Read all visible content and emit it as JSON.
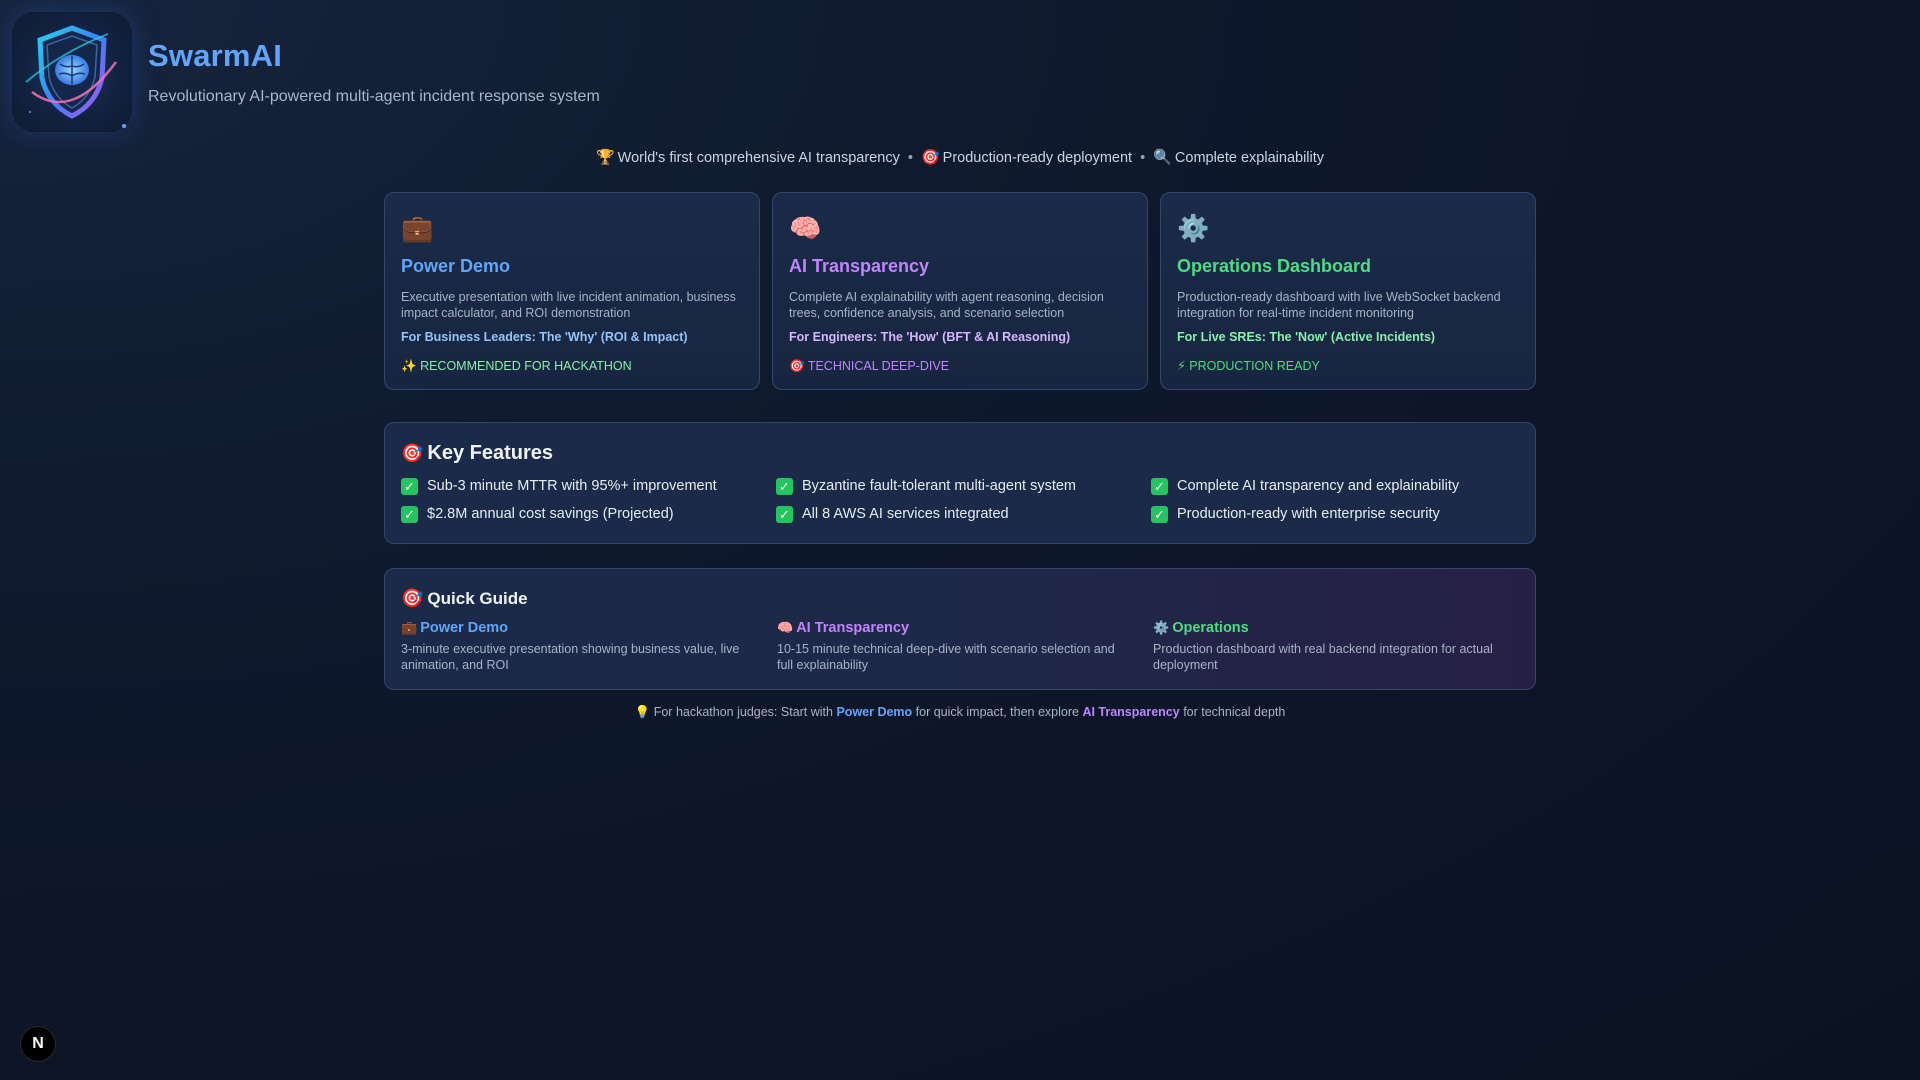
{
  "header": {
    "title": "SwarmAI",
    "subtitle": "Revolutionary AI-powered multi-agent incident response system",
    "logo_icon": "shield-brain-logo"
  },
  "tagline": {
    "items": [
      {
        "emoji": "🏆",
        "text": "World's first comprehensive AI transparency"
      },
      {
        "emoji": "🎯",
        "text": "Production-ready deployment"
      },
      {
        "emoji": "🔍",
        "text": "Complete explainability"
      }
    ],
    "separator": "•"
  },
  "cards": [
    {
      "icon": "💼",
      "icon_name": "briefcase-icon",
      "title": "Power Demo",
      "description": "Executive presentation with live incident animation, business impact calculator, and ROI demonstration",
      "audience": "For Business Leaders: The 'Why' (ROI & Impact)",
      "badge_emoji": "✨",
      "badge": "RECOMMENDED FOR HACKATHON",
      "accent": "#60a5fa"
    },
    {
      "icon": "🧠",
      "icon_name": "brain-icon",
      "title": "AI Transparency",
      "description": "Complete AI explainability with agent reasoning, decision trees, confidence analysis, and scenario selection",
      "audience": "For Engineers: The 'How' (BFT & AI Reasoning)",
      "badge_emoji": "🎯",
      "badge": "TECHNICAL DEEP-DIVE",
      "accent": "#c084fc"
    },
    {
      "icon": "⚙️",
      "icon_name": "gear-icon",
      "title": "Operations Dashboard",
      "description": "Production-ready dashboard with live WebSocket backend integration for real-time incident monitoring",
      "audience": "For Live SREs: The 'Now' (Active Incidents)",
      "badge_emoji": "⚡",
      "badge": "PRODUCTION READY",
      "accent": "#4ade80"
    }
  ],
  "features": {
    "emoji": "🎯",
    "title": "Key Features",
    "check_glyph": "✓",
    "items": [
      "Sub-3 minute MTTR with 95%+ improvement",
      "Byzantine fault-tolerant multi-agent system",
      "Complete AI transparency and explainability",
      "$2.8M annual cost savings (Projected)",
      "All 8 AWS AI services integrated",
      "Production-ready with enterprise security"
    ]
  },
  "guide": {
    "emoji": "🎯",
    "title": "Quick Guide",
    "items": [
      {
        "emoji": "💼",
        "title": "Power Demo",
        "description": "3-minute executive presentation showing business value, live animation, and ROI"
      },
      {
        "emoji": "🧠",
        "title": "AI Transparency",
        "description": "10-15 minute technical deep-dive with scenario selection and full explainability"
      },
      {
        "emoji": "⚙️",
        "title": "Operations",
        "description": "Production dashboard with real backend integration for actual deployment"
      }
    ]
  },
  "hint": {
    "emoji": "💡",
    "prefix": "For hackathon judges: Start with",
    "link1": "Power Demo",
    "middle": "for quick impact, then explore",
    "link2": "AI Transparency",
    "suffix": "for technical depth"
  },
  "next_badge": {
    "label": "N"
  },
  "colors": {
    "background": "#0f1a2e",
    "card_background": "#1a2a48",
    "card_border": "#33476a",
    "brand": "#60a5fa",
    "check": "#22c55e"
  }
}
